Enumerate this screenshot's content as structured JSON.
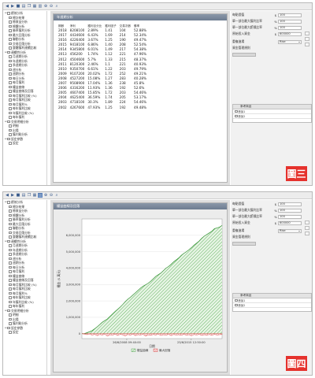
{
  "panel1": {
    "doc_title": "年週期分析",
    "headers": [
      "期數",
      "淨利",
      "獲利百分比",
      "獲利因子",
      "交易次數",
      "勝率"
    ],
    "rows": [
      [
        "2018",
        "8208100",
        "2.89%",
        "1.41",
        "104",
        "52.88%"
      ],
      [
        "2017",
        "4434600",
        "6.43%",
        "1.69",
        "214",
        "52.34%"
      ],
      [
        "2016",
        "4226400",
        "3.67%",
        "1.25",
        "190",
        "49.47%"
      ],
      [
        "2015",
        "9418100",
        "6.86%",
        "1.40",
        "208",
        "52.54%"
      ],
      [
        "2014",
        "9345800",
        "6.01%",
        "1.49",
        "217",
        "54.38%"
      ],
      [
        "2013",
        "456200",
        "1.74%",
        "1.12",
        "221",
        "47.96%"
      ],
      [
        "2012",
        "4504600",
        "5.7%",
        "1.33",
        "215",
        "48.37%"
      ],
      [
        "2011",
        "8120300",
        "2.46%",
        "1.1",
        "221",
        "40.93%"
      ],
      [
        "2010",
        "9350700",
        "6.61%",
        "1.22",
        "203",
        "49.79%"
      ],
      [
        "2009",
        "9107200",
        "20.02%",
        "1.72",
        "252",
        "49.21%"
      ],
      [
        "2008",
        "4527200",
        "15.08%",
        "1.27",
        "283",
        "40.28%"
      ],
      [
        "2007",
        "9508900",
        "17.04%",
        "1.36",
        "238",
        "45.8%"
      ],
      [
        "2006",
        "4316200",
        "11.93%",
        "1.36",
        "192",
        "52.6%"
      ],
      [
        "2005",
        "4607400",
        "15.85%",
        "1.72",
        "203",
        "54.46%"
      ],
      [
        "2004",
        "4625400",
        "36.59%",
        "1.74",
        "205",
        "53.17%"
      ],
      [
        "2003",
        "4718100",
        "30.3%",
        "1.89",
        "224",
        "54.46%"
      ],
      [
        "2002",
        "4267600",
        "47.93%",
        "1.25",
        "192",
        "49.48%"
      ]
    ],
    "badge": "圖三"
  },
  "panel2": {
    "doc_title": "權益曲線及回落",
    "badge": "圖四"
  },
  "tree_items": [
    {
      "label": "績效分析",
      "level": 0,
      "toggle": "⊟"
    },
    {
      "label": "總計結果",
      "level": 1
    },
    {
      "label": "總收益分析",
      "level": 1
    },
    {
      "label": "總體分析",
      "level": 1
    },
    {
      "label": "勝率獲利分析",
      "level": 1
    },
    {
      "label": "最大回落分析",
      "level": 1
    },
    {
      "label": "聯動分析",
      "level": 1
    },
    {
      "label": "交易回落分析",
      "level": 1
    },
    {
      "label": "整體獲利連續比較",
      "level": 1
    },
    {
      "label": "連續性分析",
      "level": 0,
      "toggle": "⊟"
    },
    {
      "label": "月週期分析",
      "level": 1
    },
    {
      "label": "年週期分析",
      "level": 1
    },
    {
      "label": "季週期分析",
      "level": 1
    },
    {
      "label": "週分析",
      "level": 1
    },
    {
      "label": "週期分析",
      "level": 1
    },
    {
      "label": "每日分析",
      "level": 1
    },
    {
      "label": "每月獲利",
      "level": 1
    },
    {
      "label": "權益曲線",
      "level": 1
    },
    {
      "label": "權益曲線及回落",
      "level": 1
    },
    {
      "label": "每月獲利比較 (%)",
      "level": 1
    },
    {
      "label": "每月獲利比較",
      "level": 1
    },
    {
      "label": "每月獲利%",
      "level": 1
    },
    {
      "label": "每年獲利比較",
      "level": 1
    },
    {
      "label": "年獲利比較 (%)",
      "level": 1
    },
    {
      "label": "每年獲利",
      "level": 1
    },
    {
      "label": "交易明細分析",
      "level": 0,
      "toggle": "⊟"
    },
    {
      "label": "明細",
      "level": 1
    },
    {
      "label": "出場",
      "level": 1
    },
    {
      "label": "獲利點分析",
      "level": 1
    },
    {
      "label": "設定參數",
      "level": 0,
      "toggle": "⊟"
    },
    {
      "label": "設定",
      "level": 1
    }
  ],
  "right_panel": {
    "rows": [
      {
        "label": "每點價值",
        "sym": "$",
        "value": "100"
      },
      {
        "label": "單一部位最大獲利比率",
        "sym": "%",
        "value": "100"
      },
      {
        "label": "單一部位最大虧損比率",
        "sym": "%",
        "value": "100"
      },
      {
        "label": "原始投入資金",
        "sym": "$",
        "value": "600000"
      }
    ],
    "rows2": [
      {
        "label": "重複進場",
        "value": "Rise"
      },
      {
        "label": "資金管理規則",
        "value": ""
      }
    ],
    "sub_header": "參考商品",
    "sub_rows": [
      "數據1",
      "數據2"
    ]
  },
  "chart_data": {
    "type": "area",
    "ylabel": "權益 ($ 萬元)",
    "xlabel": "日期",
    "x_ticks": [
      "26/6/2008 09:40:00",
      "23/6/2015 12:50:00"
    ],
    "y_ticks": [
      "0",
      "1,000,000",
      "2,000,000",
      "3,000,000",
      "4,000,000",
      "5,000,000",
      "6,000,000"
    ],
    "ylim": [
      -300000,
      7000000
    ],
    "legend": [
      {
        "name": "權益曲線",
        "color": "#2f8f2f"
      },
      {
        "name": "最大回落",
        "color": "#d03030"
      }
    ],
    "series": [
      {
        "name": "權益曲線",
        "color": "#2f8f2f",
        "values": [
          0,
          10000,
          60000,
          120000,
          190000,
          300000,
          420000,
          560000,
          700000,
          800000,
          900000,
          1050000,
          1200000,
          1350000,
          1480000,
          1620000,
          1780000,
          1950000,
          2100000,
          2220000,
          2360000,
          2500000,
          2640000,
          2780000,
          2900000,
          2980000,
          3080000,
          3200000,
          3350000,
          3500000,
          3600000,
          3700000,
          3850000,
          4000000,
          4100000,
          4230000,
          4380000,
          4500000,
          4620000,
          4780000,
          4900000,
          5000000,
          5120000,
          5250000,
          5400000,
          5520000,
          5650000,
          5820000,
          5950000,
          6050000,
          6150000,
          6250000,
          6400000,
          6450000,
          6500000,
          6600000
        ]
      },
      {
        "name": "最大回落",
        "color": "#d03030",
        "values": [
          0,
          -30000,
          -60000,
          -20000,
          -90000,
          -40000,
          -120000,
          -50000,
          -80000,
          -30000,
          -150000,
          -60000,
          -90000,
          -30000,
          -110000,
          -40000,
          -70000,
          -140000,
          -50000,
          -90000,
          -30000,
          -120000,
          -60000,
          -80000,
          -40000,
          -150000,
          -70000,
          -100000,
          -50000,
          -80000,
          -30000,
          -110000,
          -60000,
          -90000,
          -40000,
          -120000,
          -50000,
          -80000,
          -60000,
          -100000,
          -40000,
          -90000,
          -60000,
          -130000,
          -50000,
          -80000,
          -40000,
          -110000,
          -60000,
          -90000,
          -50000,
          -100000,
          -40000,
          -80000,
          -60000,
          -50000
        ]
      }
    ]
  }
}
